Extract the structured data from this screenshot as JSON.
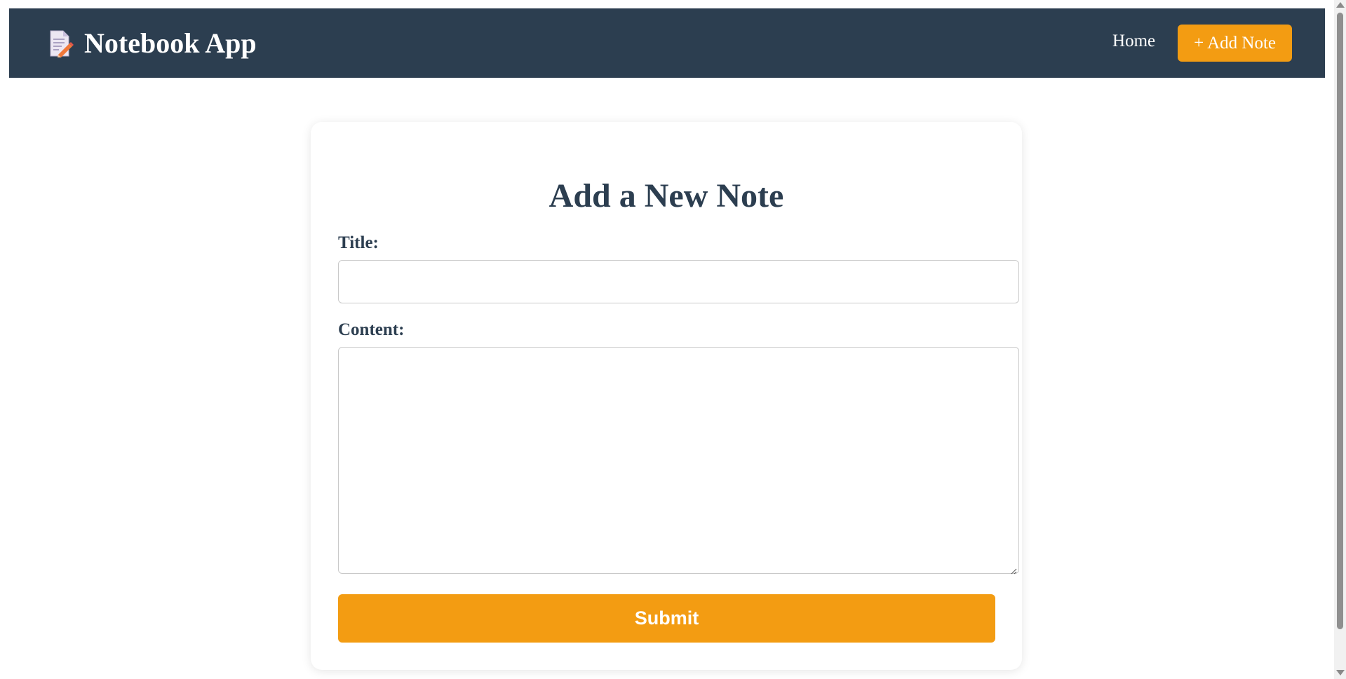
{
  "header": {
    "app_title": "Notebook App",
    "logo_icon": "notepad-pencil-icon",
    "background_color": "#2c3e50"
  },
  "nav": {
    "home_label": "Home",
    "add_note_label": "+ Add Note",
    "accent_color": "#f39c12"
  },
  "form": {
    "heading": "Add a New Note",
    "title_label": "Title:",
    "title_value": "",
    "content_label": "Content:",
    "content_value": "",
    "submit_label": "Submit"
  }
}
